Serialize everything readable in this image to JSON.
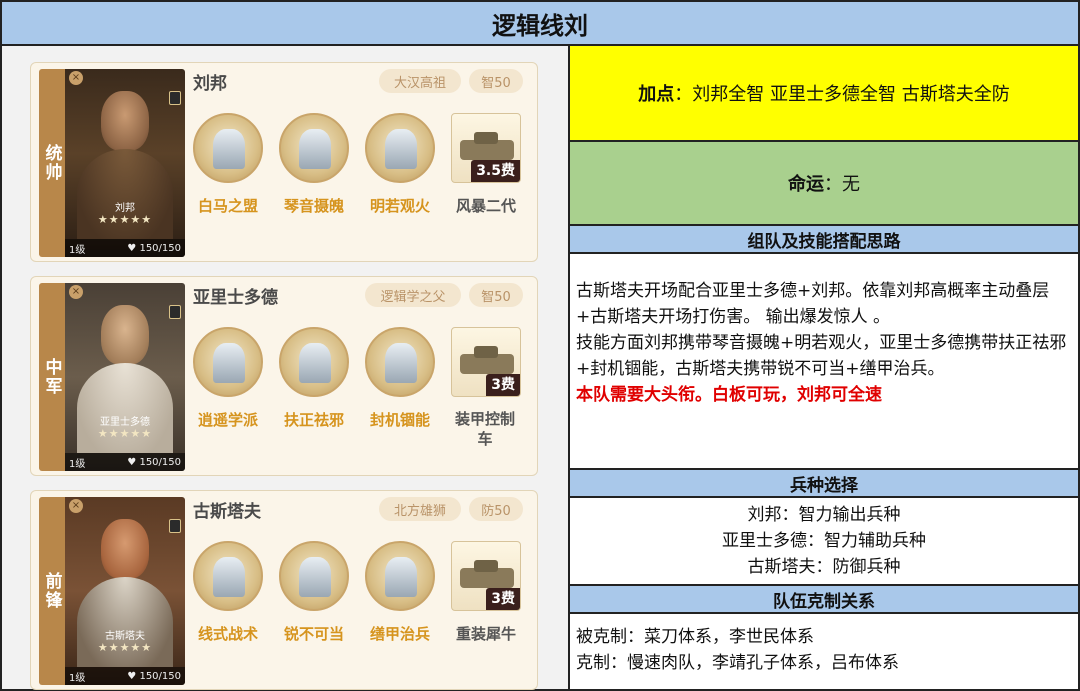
{
  "title": "逻辑线刘",
  "heroes": [
    {
      "role": "统帅",
      "name": "刘邦",
      "portrait_name": "刘邦",
      "stars": "★★★★★",
      "level": "1级",
      "hp": "150/150",
      "tag1": "大汉高祖",
      "tag2": "智50",
      "skills": [
        "白马之盟",
        "琴音摄魄",
        "明若观火"
      ],
      "vehicle": "风暴二代",
      "cost": "3.5费"
    },
    {
      "role": "中军",
      "name": "亚里士多德",
      "portrait_name": "亚里士多德",
      "stars": "★★★★★",
      "level": "1级",
      "hp": "150/150",
      "tag1": "逻辑学之父",
      "tag2": "智50",
      "skills": [
        "逍遥学派",
        "扶正祛邪",
        "封机锢能"
      ],
      "vehicle": "装甲控制车",
      "cost": "3费"
    },
    {
      "role": "前锋",
      "name": "古斯塔夫",
      "portrait_name": "古斯塔夫",
      "stars": "★★★★★",
      "level": "1级",
      "hp": "150/150",
      "tag1": "北方雄狮",
      "tag2": "防50",
      "skills": [
        "线式战术",
        "锐不可当",
        "缮甲治兵"
      ],
      "vehicle": "重装犀牛",
      "cost": "3费"
    }
  ],
  "points": {
    "label": "加点",
    "sep": "：",
    "text": "刘邦全智 亚里士多德全智 古斯塔夫全防"
  },
  "fate": {
    "label": "命运",
    "sep": "：",
    "text": "无"
  },
  "strategy": {
    "header": "组队及技能搭配思路",
    "para1": "古斯塔夫开场配合亚里士多德+刘邦。依靠刘邦高概率主动叠层+古斯塔夫开场打伤害。 输出爆发惊人 。",
    "para2": "技能方面刘邦携带琴音摄魄+明若观火，亚里士多德携带扶正祛邪+封机锢能，古斯塔夫携带锐不可当+缮甲治兵。",
    "note": "本队需要大头衔。白板可玩，刘邦可全速"
  },
  "troops": {
    "header": "兵种选择",
    "lines": [
      "刘邦：智力输出兵种",
      "亚里士多德：智力辅助兵种",
      "古斯塔夫：防御兵种"
    ]
  },
  "counter": {
    "header": "队伍克制关系",
    "countered_by": "被克制：菜刀体系，李世民体系",
    "counters": "克制：慢速肉队，李靖孔子体系，吕布体系"
  }
}
